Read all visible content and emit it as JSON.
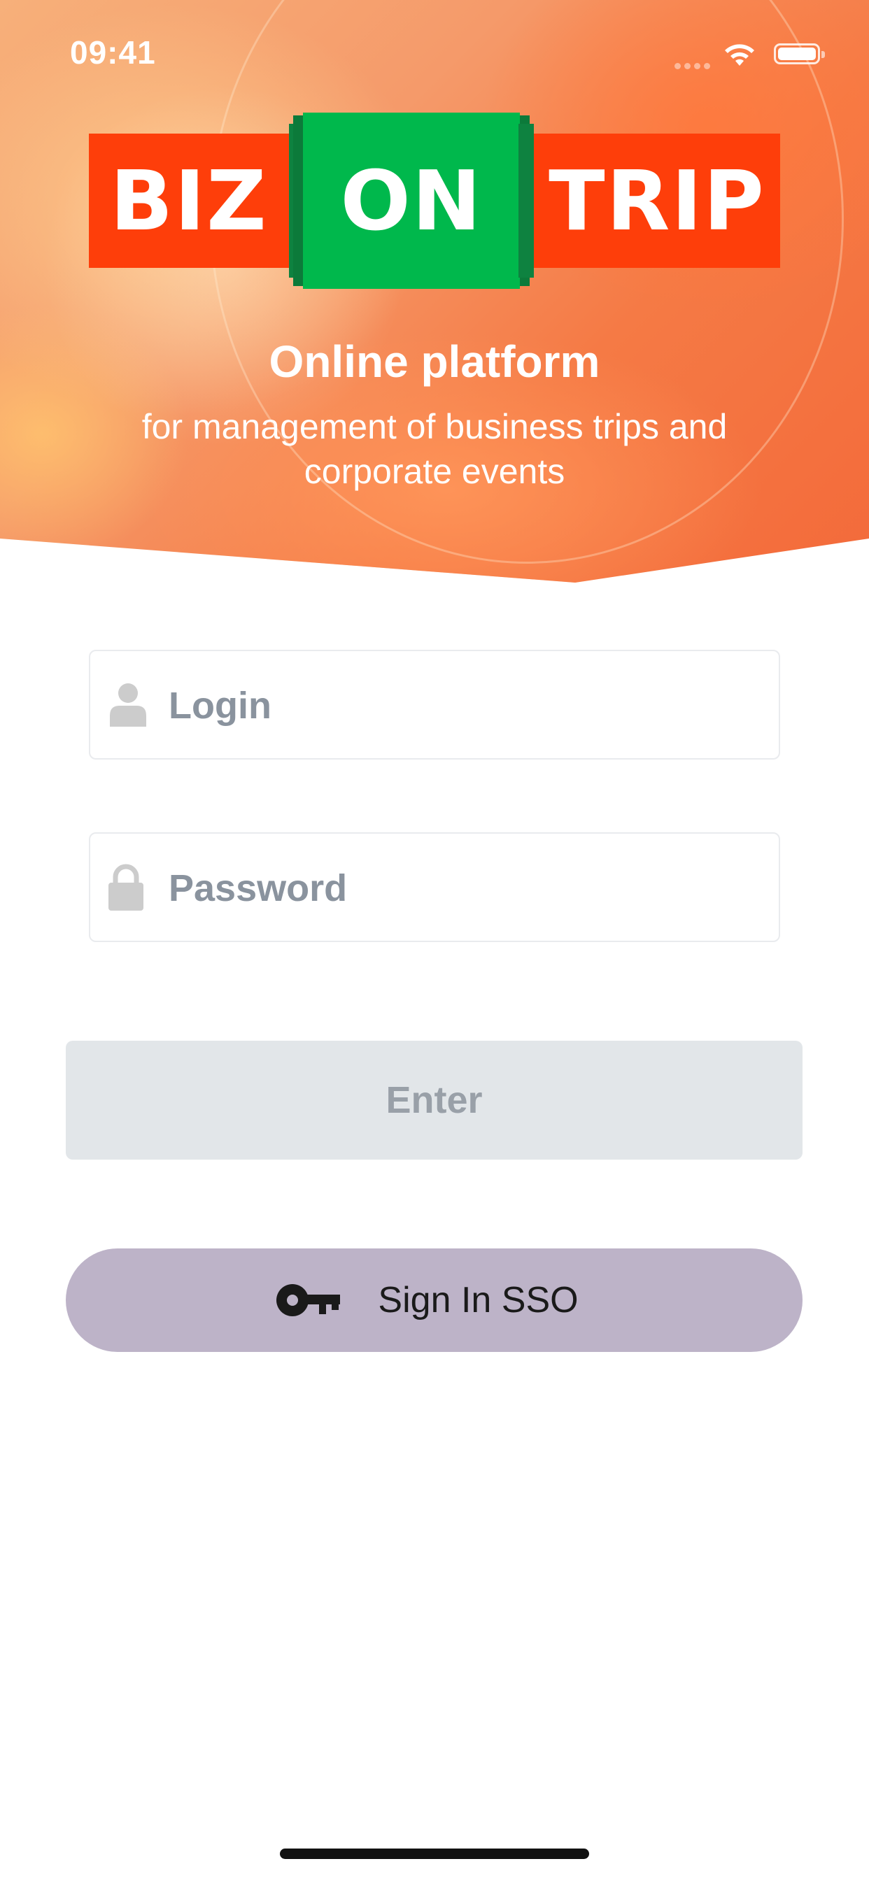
{
  "status_bar": {
    "time": "09:41"
  },
  "logo": {
    "part1": "BIZ",
    "part2": "ON",
    "part3": "TRIP"
  },
  "hero": {
    "title": "Online platform",
    "subtitle": "for management of business trips and corporate events"
  },
  "form": {
    "login": {
      "placeholder": "Login",
      "value": "",
      "icon": "user-icon"
    },
    "password": {
      "placeholder": "Password",
      "value": "",
      "icon": "lock-icon"
    }
  },
  "actions": {
    "enter_label": "Enter",
    "sso_label": "Sign In SSO",
    "sso_icon": "key-icon"
  },
  "colors": {
    "logo_red": "#fe3e0a",
    "logo_green": "#00b84c",
    "enter_bg": "#e2e6e9",
    "sso_bg": "#bdb3c8"
  }
}
